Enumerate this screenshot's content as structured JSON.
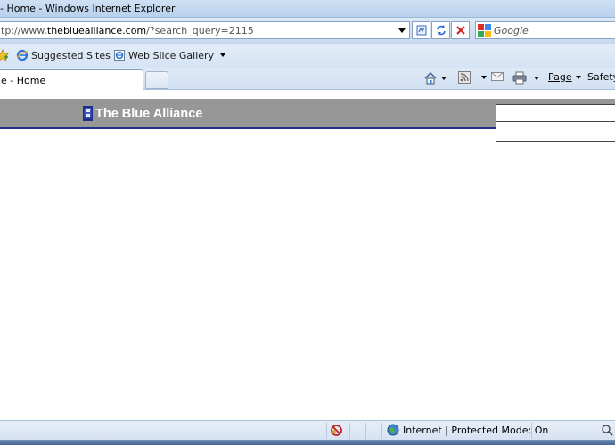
{
  "window": {
    "title": "- Home - Windows Internet Explorer"
  },
  "address_bar": {
    "url_prefix": "tp://www.",
    "url_domain": "thebluealliance.com",
    "url_path": "/?search_query=2115"
  },
  "search_bar": {
    "placeholder": "Google"
  },
  "favorites_bar": {
    "items": [
      {
        "label": "Suggested Sites",
        "icon": "ie-icon"
      },
      {
        "label": "Web Slice Gallery",
        "icon": "webslice-icon"
      }
    ]
  },
  "tabs": [
    {
      "label": "e - Home"
    }
  ],
  "command_bar": {
    "page_label": "Page",
    "safety_label": "Safety"
  },
  "page": {
    "site_title": "The Blue Alliance"
  },
  "status_bar": {
    "zone_text": "Internet | Protected Mode: On"
  },
  "colors": {
    "header_bg": "#979797",
    "header_border": "#1d2f8c",
    "chrome_blue": "#c8daf0"
  }
}
